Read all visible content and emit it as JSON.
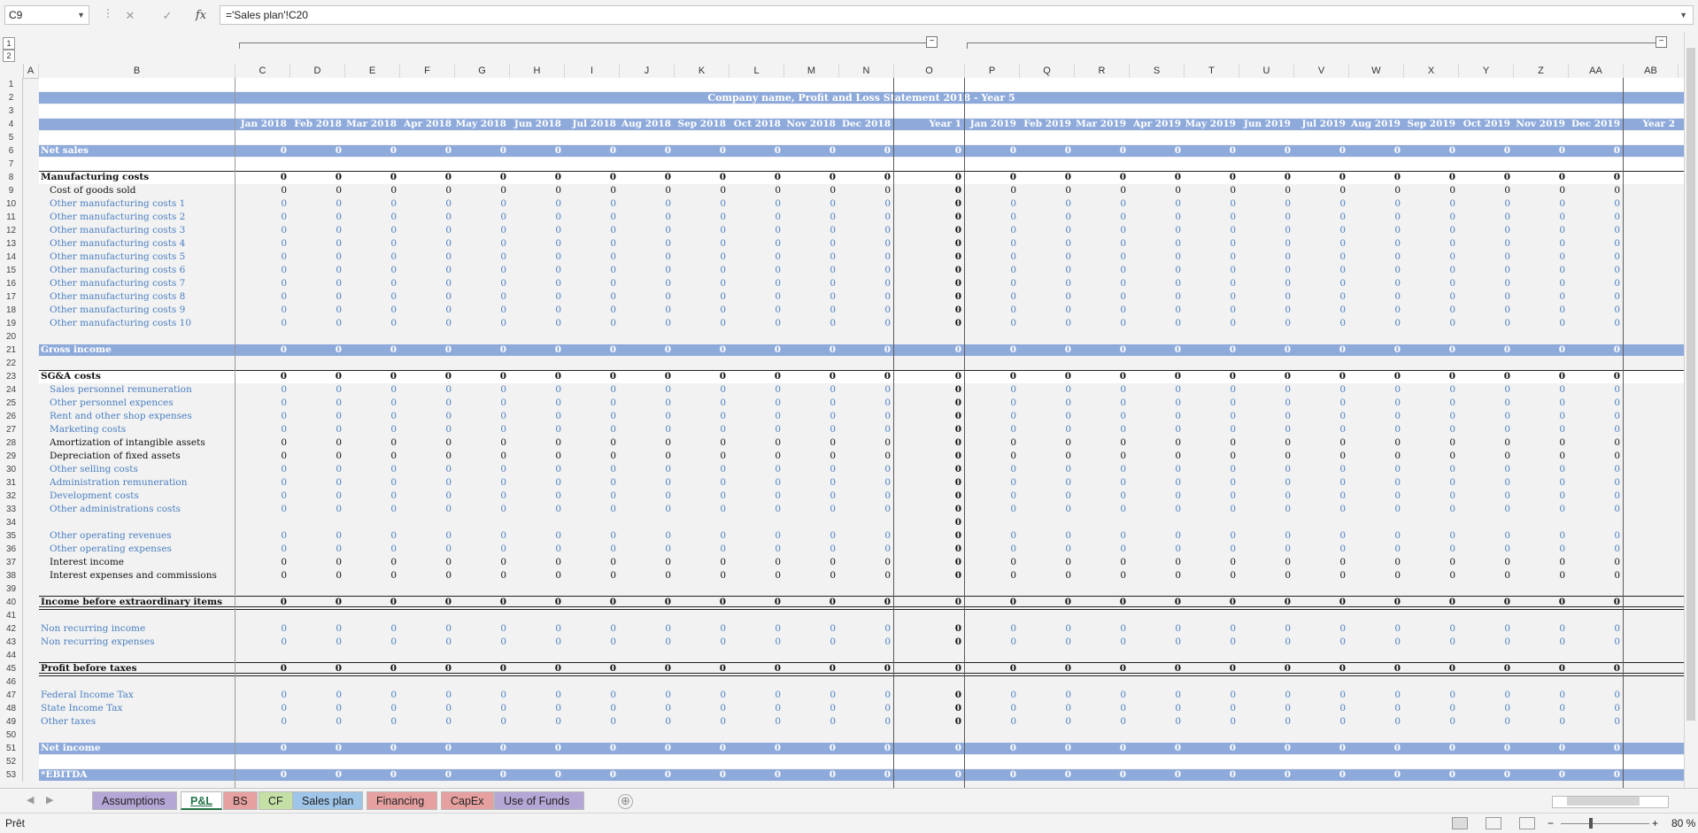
{
  "formula_bar": {
    "name_box": "C9",
    "cancel_glyph": "✕",
    "enter_glyph": "✓",
    "fx_label": "fx",
    "formula": "='Sales plan'!C20"
  },
  "outline": {
    "level1": "1",
    "level2": "2",
    "collapse": "−"
  },
  "columns": [
    "A",
    "B",
    "C",
    "D",
    "E",
    "F",
    "G",
    "H",
    "I",
    "J",
    "K",
    "L",
    "M",
    "N",
    "O",
    "P",
    "Q",
    "R",
    "S",
    "T",
    "U",
    "V",
    "W",
    "X",
    "Y",
    "Z",
    "AA",
    "AB"
  ],
  "sheet": {
    "title": "Company name, Profit and Loss Statement 2018 - Year 5",
    "months_2018": [
      "Jan 2018",
      "Feb 2018",
      "Mar 2018",
      "Apr 2018",
      "May 2018",
      "Jun 2018",
      "Jul 2018",
      "Aug 2018",
      "Sep 2018",
      "Oct 2018",
      "Nov 2018",
      "Dec 2018"
    ],
    "year1": "Year 1",
    "months_2019": [
      "Jan 2019",
      "Feb 2019",
      "Mar 2019",
      "Apr 2019",
      "May 2019",
      "Jun 2019",
      "Jul 2019",
      "Aug 2019",
      "Sep 2019",
      "Oct 2019",
      "Nov 2019",
      "Dec 2019"
    ],
    "year2": "Year 2",
    "zero": "0",
    "rows": [
      {
        "n": "1",
        "type": "white"
      },
      {
        "n": "2",
        "type": "title"
      },
      {
        "n": "3",
        "type": "white"
      },
      {
        "n": "4",
        "type": "header"
      },
      {
        "n": "5",
        "type": "white"
      },
      {
        "n": "6",
        "type": "band",
        "label": "Net sales"
      },
      {
        "n": "7",
        "type": "white"
      },
      {
        "n": "8",
        "type": "section",
        "label": "Manufacturing costs",
        "color": "black"
      },
      {
        "n": "9",
        "type": "item",
        "label": "Cost of goods sold",
        "color": "black"
      },
      {
        "n": "10",
        "type": "item",
        "label": "Other manufacturing costs 1",
        "color": "blue"
      },
      {
        "n": "11",
        "type": "item",
        "label": "Other manufacturing costs 2",
        "color": "blue"
      },
      {
        "n": "12",
        "type": "item",
        "label": "Other manufacturing costs 3",
        "color": "blue"
      },
      {
        "n": "13",
        "type": "item",
        "label": "Other manufacturing costs 4",
        "color": "blue"
      },
      {
        "n": "14",
        "type": "item",
        "label": "Other manufacturing costs 5",
        "color": "blue"
      },
      {
        "n": "15",
        "type": "item",
        "label": "Other manufacturing costs 6",
        "color": "blue"
      },
      {
        "n": "16",
        "type": "item",
        "label": "Other manufacturing costs 7",
        "color": "blue"
      },
      {
        "n": "17",
        "type": "item",
        "label": "Other manufacturing costs 8",
        "color": "blue"
      },
      {
        "n": "18",
        "type": "item",
        "label": "Other manufacturing costs 9",
        "color": "blue"
      },
      {
        "n": "19",
        "type": "item",
        "label": "Other manufacturing costs 10",
        "color": "blue"
      },
      {
        "n": "20",
        "type": "empty"
      },
      {
        "n": "21",
        "type": "band",
        "label": "Gross income"
      },
      {
        "n": "22",
        "type": "empty"
      },
      {
        "n": "23",
        "type": "section",
        "label": "SG&A costs",
        "color": "black"
      },
      {
        "n": "24",
        "type": "item",
        "label": "Sales personnel remuneration",
        "color": "blue"
      },
      {
        "n": "25",
        "type": "item",
        "label": "Other personnel expences",
        "color": "blue"
      },
      {
        "n": "26",
        "type": "item",
        "label": "Rent and other shop expenses",
        "color": "blue"
      },
      {
        "n": "27",
        "type": "item",
        "label": "Marketing costs",
        "color": "blue"
      },
      {
        "n": "28",
        "type": "item",
        "label": "Amortization of intangible assets",
        "color": "black"
      },
      {
        "n": "29",
        "type": "item",
        "label": "Depreciation of fixed assets",
        "color": "black"
      },
      {
        "n": "30",
        "type": "item",
        "label": "Other selling costs",
        "color": "blue"
      },
      {
        "n": "31",
        "type": "item",
        "label": "Administration remuneration",
        "color": "blue"
      },
      {
        "n": "32",
        "type": "item",
        "label": "Development costs",
        "color": "blue"
      },
      {
        "n": "33",
        "type": "item",
        "label": "Other administrations costs",
        "color": "blue"
      },
      {
        "n": "34",
        "type": "yearonly"
      },
      {
        "n": "35",
        "type": "item",
        "label": "Other operating revenues",
        "color": "blue"
      },
      {
        "n": "36",
        "type": "item",
        "label": "Other operating expenses",
        "color": "blue"
      },
      {
        "n": "37",
        "type": "item",
        "label": "Interest income",
        "color": "black"
      },
      {
        "n": "38",
        "type": "item",
        "label": "Interest expenses and commissions",
        "color": "black"
      },
      {
        "n": "39",
        "type": "empty"
      },
      {
        "n": "40",
        "type": "total",
        "label": "Income before extraordinary items"
      },
      {
        "n": "41",
        "type": "empty"
      },
      {
        "n": "42",
        "type": "item0",
        "label": "Non recurring income",
        "color": "blue"
      },
      {
        "n": "43",
        "type": "item0",
        "label": "Non recurring expenses",
        "color": "blue"
      },
      {
        "n": "44",
        "type": "empty"
      },
      {
        "n": "45",
        "type": "total",
        "label": "Profit before taxes"
      },
      {
        "n": "46",
        "type": "empty"
      },
      {
        "n": "47",
        "type": "item0",
        "label": "Federal Income Tax",
        "color": "blue"
      },
      {
        "n": "48",
        "type": "item0",
        "label": "State Income Tax",
        "color": "blue"
      },
      {
        "n": "49",
        "type": "item0",
        "label": "Other taxes",
        "color": "blue"
      },
      {
        "n": "50",
        "type": "empty"
      },
      {
        "n": "51",
        "type": "band",
        "label": "Net income"
      },
      {
        "n": "52",
        "type": "white"
      },
      {
        "n": "53",
        "type": "band",
        "label": "*EBITDA"
      }
    ]
  },
  "tabs": [
    {
      "label": "Assumptions",
      "color": "#b4a7d6"
    },
    {
      "label": "P&L",
      "color": "#ffffff",
      "active": true
    },
    {
      "label": "BS",
      "color": "#e6a0a0"
    },
    {
      "label": "CF",
      "color": "#c5e0a5"
    },
    {
      "label": "Sales plan",
      "color": "#9fc5e8"
    },
    {
      "label": "Financing",
      "color": "#e6a0a0"
    },
    {
      "label": "CapEx",
      "color": "#e6a0a0"
    },
    {
      "label": "Use of Funds",
      "color": "#b4a7d6"
    }
  ],
  "status": {
    "ready": "Prêt",
    "zoom": "80 %",
    "zoom_minus": "−",
    "zoom_plus": "+"
  },
  "icons": {
    "nav_prev": "◀",
    "nav_next": "▶",
    "add_sheet": "⊕",
    "dropdown": "▼"
  }
}
